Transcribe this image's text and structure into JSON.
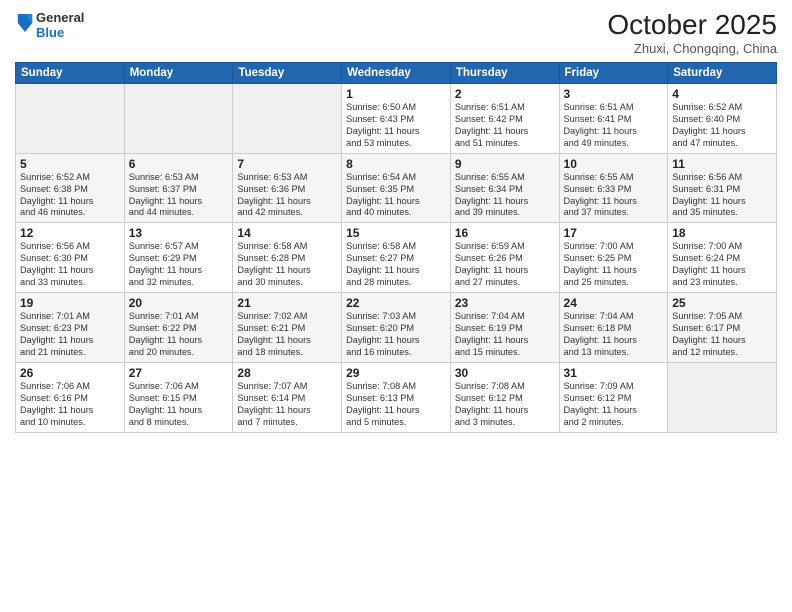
{
  "header": {
    "logo_general": "General",
    "logo_blue": "Blue",
    "month": "October 2025",
    "location": "Zhuxi, Chongqing, China"
  },
  "days_of_week": [
    "Sunday",
    "Monday",
    "Tuesday",
    "Wednesday",
    "Thursday",
    "Friday",
    "Saturday"
  ],
  "weeks": [
    [
      {
        "day": "",
        "info": ""
      },
      {
        "day": "",
        "info": ""
      },
      {
        "day": "",
        "info": ""
      },
      {
        "day": "1",
        "info": "Sunrise: 6:50 AM\nSunset: 6:43 PM\nDaylight: 11 hours\nand 53 minutes."
      },
      {
        "day": "2",
        "info": "Sunrise: 6:51 AM\nSunset: 6:42 PM\nDaylight: 11 hours\nand 51 minutes."
      },
      {
        "day": "3",
        "info": "Sunrise: 6:51 AM\nSunset: 6:41 PM\nDaylight: 11 hours\nand 49 minutes."
      },
      {
        "day": "4",
        "info": "Sunrise: 6:52 AM\nSunset: 6:40 PM\nDaylight: 11 hours\nand 47 minutes."
      }
    ],
    [
      {
        "day": "5",
        "info": "Sunrise: 6:52 AM\nSunset: 6:38 PM\nDaylight: 11 hours\nand 46 minutes."
      },
      {
        "day": "6",
        "info": "Sunrise: 6:53 AM\nSunset: 6:37 PM\nDaylight: 11 hours\nand 44 minutes."
      },
      {
        "day": "7",
        "info": "Sunrise: 6:53 AM\nSunset: 6:36 PM\nDaylight: 11 hours\nand 42 minutes."
      },
      {
        "day": "8",
        "info": "Sunrise: 6:54 AM\nSunset: 6:35 PM\nDaylight: 11 hours\nand 40 minutes."
      },
      {
        "day": "9",
        "info": "Sunrise: 6:55 AM\nSunset: 6:34 PM\nDaylight: 11 hours\nand 39 minutes."
      },
      {
        "day": "10",
        "info": "Sunrise: 6:55 AM\nSunset: 6:33 PM\nDaylight: 11 hours\nand 37 minutes."
      },
      {
        "day": "11",
        "info": "Sunrise: 6:56 AM\nSunset: 6:31 PM\nDaylight: 11 hours\nand 35 minutes."
      }
    ],
    [
      {
        "day": "12",
        "info": "Sunrise: 6:56 AM\nSunset: 6:30 PM\nDaylight: 11 hours\nand 33 minutes."
      },
      {
        "day": "13",
        "info": "Sunrise: 6:57 AM\nSunset: 6:29 PM\nDaylight: 11 hours\nand 32 minutes."
      },
      {
        "day": "14",
        "info": "Sunrise: 6:58 AM\nSunset: 6:28 PM\nDaylight: 11 hours\nand 30 minutes."
      },
      {
        "day": "15",
        "info": "Sunrise: 6:58 AM\nSunset: 6:27 PM\nDaylight: 11 hours\nand 28 minutes."
      },
      {
        "day": "16",
        "info": "Sunrise: 6:59 AM\nSunset: 6:26 PM\nDaylight: 11 hours\nand 27 minutes."
      },
      {
        "day": "17",
        "info": "Sunrise: 7:00 AM\nSunset: 6:25 PM\nDaylight: 11 hours\nand 25 minutes."
      },
      {
        "day": "18",
        "info": "Sunrise: 7:00 AM\nSunset: 6:24 PM\nDaylight: 11 hours\nand 23 minutes."
      }
    ],
    [
      {
        "day": "19",
        "info": "Sunrise: 7:01 AM\nSunset: 6:23 PM\nDaylight: 11 hours\nand 21 minutes."
      },
      {
        "day": "20",
        "info": "Sunrise: 7:01 AM\nSunset: 6:22 PM\nDaylight: 11 hours\nand 20 minutes."
      },
      {
        "day": "21",
        "info": "Sunrise: 7:02 AM\nSunset: 6:21 PM\nDaylight: 11 hours\nand 18 minutes."
      },
      {
        "day": "22",
        "info": "Sunrise: 7:03 AM\nSunset: 6:20 PM\nDaylight: 11 hours\nand 16 minutes."
      },
      {
        "day": "23",
        "info": "Sunrise: 7:04 AM\nSunset: 6:19 PM\nDaylight: 11 hours\nand 15 minutes."
      },
      {
        "day": "24",
        "info": "Sunrise: 7:04 AM\nSunset: 6:18 PM\nDaylight: 11 hours\nand 13 minutes."
      },
      {
        "day": "25",
        "info": "Sunrise: 7:05 AM\nSunset: 6:17 PM\nDaylight: 11 hours\nand 12 minutes."
      }
    ],
    [
      {
        "day": "26",
        "info": "Sunrise: 7:06 AM\nSunset: 6:16 PM\nDaylight: 11 hours\nand 10 minutes."
      },
      {
        "day": "27",
        "info": "Sunrise: 7:06 AM\nSunset: 6:15 PM\nDaylight: 11 hours\nand 8 minutes."
      },
      {
        "day": "28",
        "info": "Sunrise: 7:07 AM\nSunset: 6:14 PM\nDaylight: 11 hours\nand 7 minutes."
      },
      {
        "day": "29",
        "info": "Sunrise: 7:08 AM\nSunset: 6:13 PM\nDaylight: 11 hours\nand 5 minutes."
      },
      {
        "day": "30",
        "info": "Sunrise: 7:08 AM\nSunset: 6:12 PM\nDaylight: 11 hours\nand 3 minutes."
      },
      {
        "day": "31",
        "info": "Sunrise: 7:09 AM\nSunset: 6:12 PM\nDaylight: 11 hours\nand 2 minutes."
      },
      {
        "day": "",
        "info": ""
      }
    ]
  ]
}
